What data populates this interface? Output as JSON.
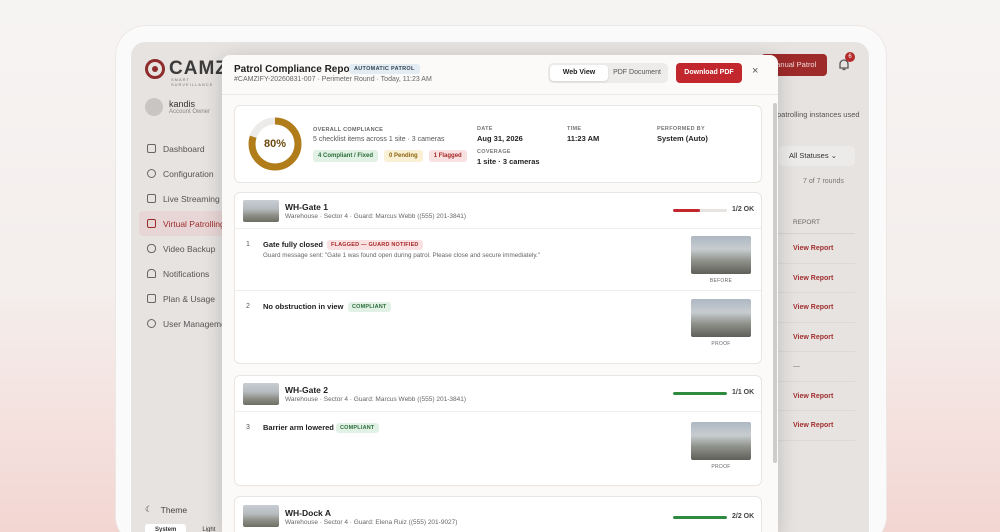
{
  "app": {
    "logo_text": "CAMZ",
    "logo_sub": "SMART SURVEILLANCE",
    "user": {
      "name": "kandis",
      "role": "Account Owner"
    },
    "nav": [
      {
        "label": "Dashboard",
        "icon": "grid-icon"
      },
      {
        "label": "Configuration",
        "icon": "gear-icon"
      },
      {
        "label": "Live Streaming",
        "icon": "camera-icon"
      },
      {
        "label": "Virtual Patrolling",
        "icon": "layers-icon"
      },
      {
        "label": "Video Backup",
        "icon": "cloud-icon"
      },
      {
        "label": "Notifications",
        "icon": "bell-icon"
      },
      {
        "label": "Plan & Usage",
        "icon": "document-icon"
      },
      {
        "label": "User Management",
        "icon": "user-icon"
      }
    ],
    "theme_label": "Theme",
    "theme_options": [
      "System",
      "Light"
    ],
    "new_patrol_button": "Manual Patrol",
    "notification_count": "6",
    "instances_text": "patrolling instances used",
    "status_filter": "All Statuses",
    "rounds_text": "7 of 7 rounds",
    "table_header": "REPORT",
    "report_links": [
      "View Report",
      "View Report",
      "View Report",
      "View Report",
      "—",
      "View Report",
      "View Report"
    ]
  },
  "modal": {
    "title": "Patrol Compliance Report",
    "badge": "AUTOMATIC PATROL",
    "subtitle": "#CAMZIFY-20260831-007 · Perimeter Round · Today, 11:23 AM",
    "views": [
      "Web View",
      "PDF Document"
    ],
    "download_label": "Download PDF",
    "close_glyph": "×",
    "summary": {
      "compliance_pct": 80,
      "compliance_text": "80%",
      "label": "OVERALL COMPLIANCE",
      "text": "5 checklist items across 1 site · 3 cameras",
      "chips": {
        "compliant": "4 Compliant / Fixed",
        "pending": "0 Pending",
        "flagged": "1 Flagged"
      },
      "date_label": "DATE",
      "date": "Aug 31, 2026",
      "time_label": "TIME",
      "time": "11:23 AM",
      "performed_label": "PERFORMED BY",
      "performed": "System (Auto)",
      "coverage_label": "COVERAGE",
      "coverage": "1 site · 3 cameras"
    },
    "cards": [
      {
        "title": "WH-Gate 1",
        "sub": "Warehouse · Sector 4 · Guard: Marcus Webb ((555) 201-3841)",
        "progress": 0.5,
        "progress_color": "#c1272d",
        "count": "1/2 OK",
        "items": [
          {
            "num": "1",
            "title": "Gate fully closed",
            "tag": "FLAGGED — GUARD NOTIFIED",
            "tag_type": "flag",
            "msg": "Guard message sent: \"Gate 1 was found open during patrol. Please close and secure immediately.\"",
            "photo_caption": "BEFORE"
          },
          {
            "num": "2",
            "title": "No obstruction in view",
            "tag": "COMPLIANT",
            "tag_type": "ok",
            "msg": "",
            "photo_caption": "PROOF"
          }
        ]
      },
      {
        "title": "WH-Gate 2",
        "sub": "Warehouse · Sector 4 · Guard: Marcus Webb ((555) 201-3841)",
        "progress": 1.0,
        "progress_color": "#2e8a3e",
        "count": "1/1 OK",
        "items": [
          {
            "num": "3",
            "title": "Barrier arm lowered",
            "tag": "COMPLIANT",
            "tag_type": "ok",
            "msg": "",
            "photo_caption": "PROOF"
          }
        ]
      },
      {
        "title": "WH-Dock A",
        "sub": "Warehouse · Sector 4 · Guard: Elena Ruiz ((555) 201-9027)",
        "progress": 1.0,
        "progress_color": "#2e8a3e",
        "count": "2/2 OK",
        "items": []
      }
    ]
  }
}
